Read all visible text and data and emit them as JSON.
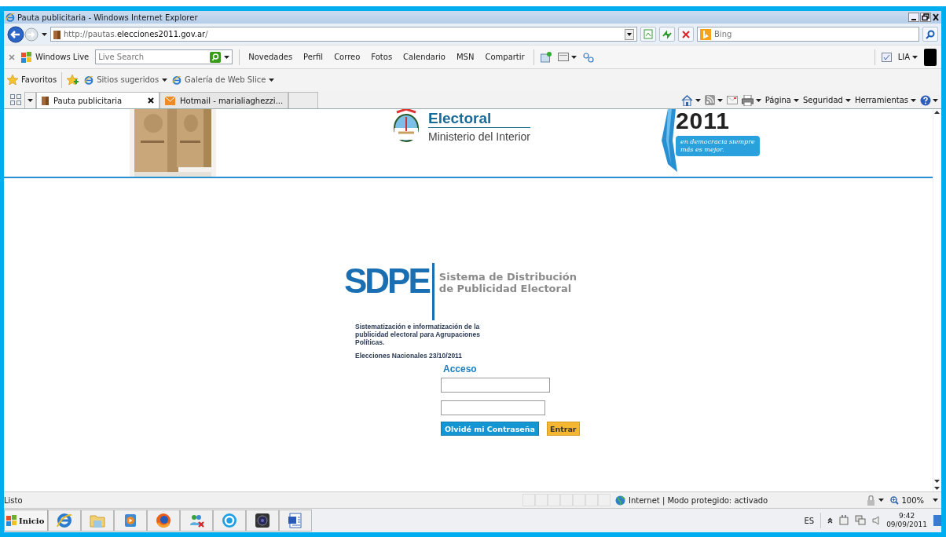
{
  "window": {
    "title": "Pauta publicitaria - Windows Internet Explorer"
  },
  "address_bar": {
    "url_prefix": "http://pautas.",
    "url_domain": "elecciones2011.gov.ar",
    "url_suffix": "/"
  },
  "search": {
    "placeholder": "Bing"
  },
  "live_toolbar": {
    "brand": "Windows Live",
    "search_placeholder": "Live Search",
    "links": [
      "Novedades",
      "Perfil",
      "Correo",
      "Fotos",
      "Calendario",
      "MSN",
      "Compartir"
    ],
    "user": "LIA"
  },
  "favorites_bar": {
    "label": "Favoritos",
    "items": [
      "Sitios sugeridos",
      "Galería de Web Slice"
    ]
  },
  "tabs": [
    {
      "label": "Pauta publicitaria",
      "selected": true
    },
    {
      "label": "Hotmail - marialiaghezzi...",
      "selected": false
    }
  ],
  "command_bar": [
    "Página",
    "Seguridad",
    "Herramientas"
  ],
  "page": {
    "banner": {
      "title": "Electoral",
      "subtitle": "Ministerio del Interior",
      "year": "2011",
      "slogan": [
        "en democracia siempre",
        "más es mejor."
      ]
    },
    "logo": {
      "acronym": "SDPE",
      "name": [
        "Sistema de Distribución",
        "de Publicidad Electoral"
      ]
    },
    "description": [
      "Sistematización e informatización de la",
      "publicidad electoral para Agrupaciones",
      "Políticas."
    ],
    "election": "Elecciones Nacionales 23/10/2011",
    "login": {
      "title": "Acceso",
      "forgot_button": "Olvidé mi Contraseña",
      "submit_button": "Entrar"
    }
  },
  "status_bar": {
    "text": "Listo",
    "zone": "Internet | Modo protegido: activado",
    "zoom": "100%"
  },
  "taskbar": {
    "start": "Inicio",
    "language": "ES",
    "time": "9:42",
    "date": "09/09/2011"
  }
}
